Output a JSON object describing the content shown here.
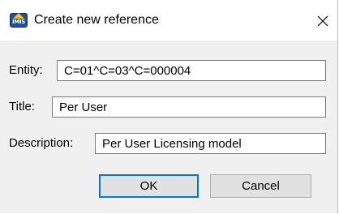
{
  "window": {
    "title": "Create new reference",
    "icon": "imis-app-icon",
    "icon_text": "iMIS",
    "close_icon": "close-icon"
  },
  "form": {
    "entity": {
      "label": "Entity:",
      "value": "C=01^C=03^C=000004"
    },
    "title": {
      "label": "Title:",
      "value": "Per User"
    },
    "description": {
      "label": "Description:",
      "value": "Per User Licensing model"
    }
  },
  "buttons": {
    "ok_label": "OK",
    "cancel_label": "Cancel"
  },
  "colors": {
    "content_background": "#f0f0f0",
    "default_button_border": "#0078d7",
    "field_border": "#7a7a7a",
    "icon_blue": "#1c4f9c",
    "icon_yellow": "#f1c21b"
  }
}
